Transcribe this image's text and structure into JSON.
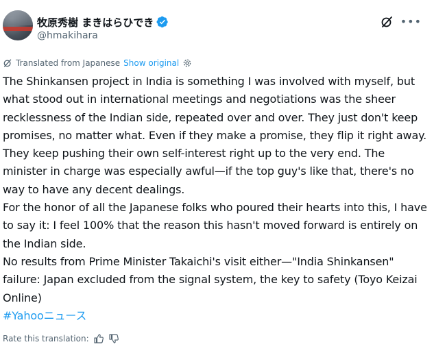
{
  "author": {
    "display_name": "牧原秀樹 まきはらひでき",
    "handle": "@hmakihara",
    "verified": true
  },
  "icons": {
    "verified": "verified-badge-icon",
    "grok": "grok-icon",
    "more": "more-options-icon",
    "translate": "translate-icon",
    "settings": "gear-icon",
    "thumbs_up": "thumbs-up-icon",
    "thumbs_down": "thumbs-down-icon"
  },
  "colors": {
    "accent": "#1d9bf0",
    "text": "#0f1419",
    "secondary": "#536471"
  },
  "translation": {
    "label": "Translated from Japanese",
    "show_original": "Show original"
  },
  "post": {
    "paragraphs": [
      "The Shinkansen project in India is something I was involved with myself, but what stood out in international meetings and negotiations was the sheer recklessness of the Indian side, repeated over and over. They just don't keep promises, no matter what. Even if they make a promise, they flip it right away. They keep pushing their own self-interest right up to the very end. The minister in charge was especially awful—if the top guy's like that, there's no way to have any decent dealings.",
      "For the honor of all the Japanese folks who poured their hearts into this, I have to say it: I feel 100% that the reason this hasn't moved forward is entirely on the Indian side.",
      "No results from Prime Minister Takaichi's visit either—\"India Shinkansen\" failure: Japan excluded from the signal system, the key to safety (Toyo Keizai Online)"
    ],
    "hashtag": "#Yahooニュース"
  },
  "rate": {
    "label": "Rate this translation:"
  }
}
